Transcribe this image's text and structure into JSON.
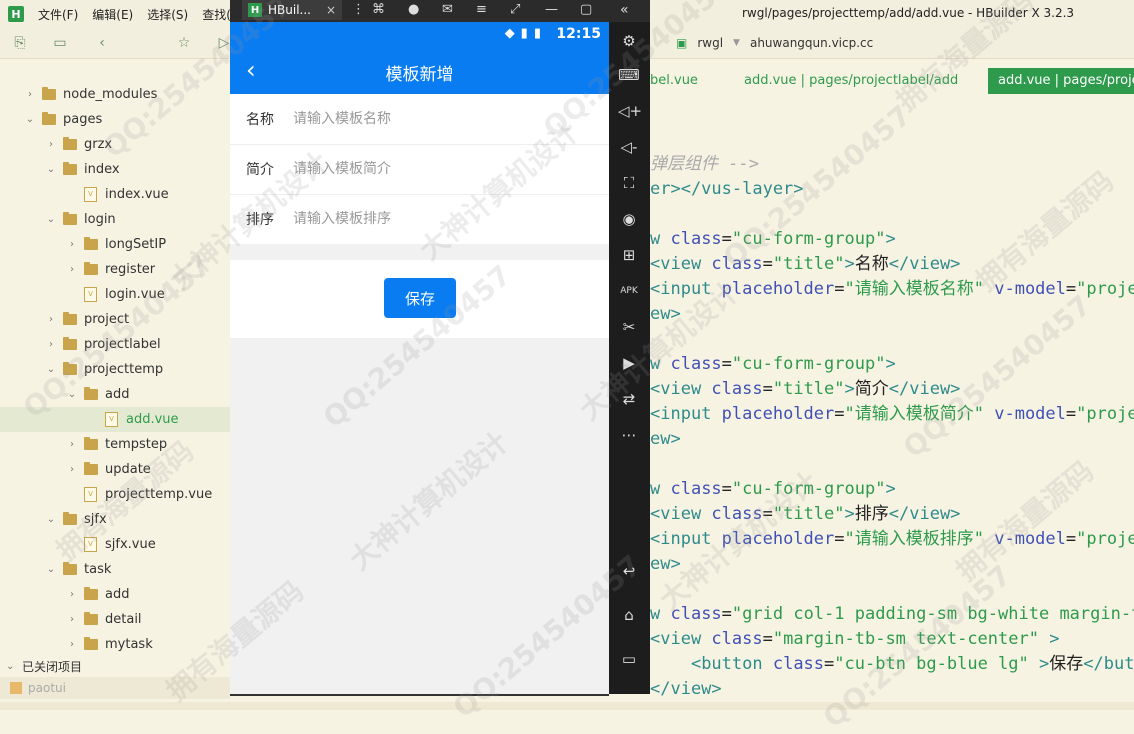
{
  "ide": {
    "window_title": "rwgl/pages/projecttemp/add/add.vue - HBuilder X 3.2.3",
    "menu": [
      "文件(F)",
      "编辑(E)",
      "选择(S)",
      "查找(I)"
    ],
    "address": {
      "project": "rwgl",
      "host": "ahuwangqun.vicp.cc"
    },
    "tabs": [
      {
        "label": "bel.vue"
      },
      {
        "label": "add.vue | pages/projectlabel/add"
      },
      {
        "label": "add.vue | pages/projec"
      }
    ],
    "tree": [
      {
        "label": "node_modules",
        "type": "folder",
        "depth": 0,
        "expanded": false
      },
      {
        "label": "pages",
        "type": "folder",
        "depth": 0,
        "expanded": true
      },
      {
        "label": "grzx",
        "type": "folder",
        "depth": 1,
        "expanded": false
      },
      {
        "label": "index",
        "type": "folder",
        "depth": 1,
        "expanded": true
      },
      {
        "label": "index.vue",
        "type": "file",
        "depth": 2
      },
      {
        "label": "login",
        "type": "folder",
        "depth": 1,
        "expanded": true
      },
      {
        "label": "longSetIP",
        "type": "folder",
        "depth": 2,
        "expanded": false
      },
      {
        "label": "register",
        "type": "folder",
        "depth": 2,
        "expanded": false
      },
      {
        "label": "login.vue",
        "type": "file",
        "depth": 2
      },
      {
        "label": "project",
        "type": "folder",
        "depth": 1,
        "expanded": false
      },
      {
        "label": "projectlabel",
        "type": "folder",
        "depth": 1,
        "expanded": false
      },
      {
        "label": "projecttemp",
        "type": "folder",
        "depth": 1,
        "expanded": true
      },
      {
        "label": "add",
        "type": "folder",
        "depth": 2,
        "expanded": true
      },
      {
        "label": "add.vue",
        "type": "file",
        "depth": 3,
        "selected": true
      },
      {
        "label": "tempstep",
        "type": "folder",
        "depth": 2,
        "expanded": false
      },
      {
        "label": "update",
        "type": "folder",
        "depth": 2,
        "expanded": false
      },
      {
        "label": "projecttemp.vue",
        "type": "file",
        "depth": 2
      },
      {
        "label": "sjfx",
        "type": "folder",
        "depth": 1,
        "expanded": true
      },
      {
        "label": "sjfx.vue",
        "type": "file",
        "depth": 2
      },
      {
        "label": "task",
        "type": "folder",
        "depth": 1,
        "expanded": true
      },
      {
        "label": "add",
        "type": "folder",
        "depth": 2,
        "expanded": false
      },
      {
        "label": "detail",
        "type": "folder",
        "depth": 2,
        "expanded": false
      },
      {
        "label": "mytask",
        "type": "folder",
        "depth": 2,
        "expanded": false
      }
    ],
    "closed_projects_label": "已关闭项目",
    "closed_project": "paotui",
    "code": [
      [
        {
          "c": "cmt",
          "t": "弹层组件 -->"
        }
      ],
      [
        {
          "c": "tag",
          "t": "er></vus-layer>"
        }
      ],
      [],
      [
        {
          "c": "tag",
          "t": "w "
        },
        {
          "c": "attr",
          "t": "class"
        },
        {
          "c": "txt",
          "t": "="
        },
        {
          "c": "str",
          "t": "\"cu-form-group\""
        },
        {
          "c": "tag",
          "t": ">"
        }
      ],
      [
        {
          "c": "tag",
          "t": "<view "
        },
        {
          "c": "attr",
          "t": "class"
        },
        {
          "c": "txt",
          "t": "="
        },
        {
          "c": "str",
          "t": "\"title\""
        },
        {
          "c": "tag",
          "t": ">"
        },
        {
          "c": "txt",
          "t": "名称"
        },
        {
          "c": "tag",
          "t": "</view>"
        }
      ],
      [
        {
          "c": "tag",
          "t": "<input "
        },
        {
          "c": "attr",
          "t": "placeholder"
        },
        {
          "c": "txt",
          "t": "="
        },
        {
          "c": "str",
          "t": "\"请输入模板名称\""
        },
        {
          "c": "txt",
          "t": " "
        },
        {
          "c": "attr",
          "t": "v-model"
        },
        {
          "c": "txt",
          "t": "="
        },
        {
          "c": "str",
          "t": "\"proje"
        }
      ],
      [
        {
          "c": "tag",
          "t": "ew>"
        }
      ],
      [],
      [
        {
          "c": "tag",
          "t": "w "
        },
        {
          "c": "attr",
          "t": "class"
        },
        {
          "c": "txt",
          "t": "="
        },
        {
          "c": "str",
          "t": "\"cu-form-group\""
        },
        {
          "c": "tag",
          "t": ">"
        }
      ],
      [
        {
          "c": "tag",
          "t": "<view "
        },
        {
          "c": "attr",
          "t": "class"
        },
        {
          "c": "txt",
          "t": "="
        },
        {
          "c": "str",
          "t": "\"title\""
        },
        {
          "c": "tag",
          "t": ">"
        },
        {
          "c": "txt",
          "t": "简介"
        },
        {
          "c": "tag",
          "t": "</view>"
        }
      ],
      [
        {
          "c": "tag",
          "t": "<input "
        },
        {
          "c": "attr",
          "t": "placeholder"
        },
        {
          "c": "txt",
          "t": "="
        },
        {
          "c": "str",
          "t": "\"请输入模板简介\""
        },
        {
          "c": "txt",
          "t": " "
        },
        {
          "c": "attr",
          "t": "v-model"
        },
        {
          "c": "txt",
          "t": "="
        },
        {
          "c": "str",
          "t": "\"proje"
        }
      ],
      [
        {
          "c": "tag",
          "t": "ew>"
        }
      ],
      [],
      [
        {
          "c": "tag",
          "t": "w "
        },
        {
          "c": "attr",
          "t": "class"
        },
        {
          "c": "txt",
          "t": "="
        },
        {
          "c": "str",
          "t": "\"cu-form-group\""
        },
        {
          "c": "tag",
          "t": ">"
        }
      ],
      [
        {
          "c": "tag",
          "t": "<view "
        },
        {
          "c": "attr",
          "t": "class"
        },
        {
          "c": "txt",
          "t": "="
        },
        {
          "c": "str",
          "t": "\"title\""
        },
        {
          "c": "tag",
          "t": ">"
        },
        {
          "c": "txt",
          "t": "排序"
        },
        {
          "c": "tag",
          "t": "</view>"
        }
      ],
      [
        {
          "c": "tag",
          "t": "<input "
        },
        {
          "c": "attr",
          "t": "placeholder"
        },
        {
          "c": "txt",
          "t": "="
        },
        {
          "c": "str",
          "t": "\"请输入模板排序\""
        },
        {
          "c": "txt",
          "t": " "
        },
        {
          "c": "attr",
          "t": "v-model"
        },
        {
          "c": "txt",
          "t": "="
        },
        {
          "c": "str",
          "t": "\"proje"
        }
      ],
      [
        {
          "c": "tag",
          "t": "ew>"
        }
      ],
      [],
      [
        {
          "c": "tag",
          "t": "w "
        },
        {
          "c": "attr",
          "t": "class"
        },
        {
          "c": "txt",
          "t": "="
        },
        {
          "c": "str",
          "t": "\"grid col-1 padding-sm bg-white margin-to"
        }
      ],
      [
        {
          "c": "tag",
          "t": "<view "
        },
        {
          "c": "attr",
          "t": "class"
        },
        {
          "c": "txt",
          "t": "="
        },
        {
          "c": "str",
          "t": "\"margin-tb-sm text-center\""
        },
        {
          "c": "txt",
          "t": " "
        },
        {
          "c": "tag",
          "t": ">"
        }
      ],
      [
        {
          "c": "txt",
          "t": "    "
        },
        {
          "c": "tag",
          "t": "<button "
        },
        {
          "c": "attr",
          "t": "class"
        },
        {
          "c": "txt",
          "t": "="
        },
        {
          "c": "str",
          "t": "\"cu-btn bg-blue lg\""
        },
        {
          "c": "txt",
          "t": " "
        },
        {
          "c": "tag",
          "t": ">"
        },
        {
          "c": "txt",
          "t": "保存"
        },
        {
          "c": "tag",
          "t": "</butt"
        }
      ],
      [
        {
          "c": "tag",
          "t": "</view>"
        }
      ]
    ]
  },
  "emulator": {
    "tab_label": "HBuil...",
    "clock": "12:15",
    "nav_title": "模板新增",
    "form": [
      {
        "label": "名称",
        "placeholder": "请输入模板名称"
      },
      {
        "label": "简介",
        "placeholder": "请输入模板简介"
      },
      {
        "label": "排序",
        "placeholder": "请输入模板排序"
      }
    ],
    "save_label": "保存"
  },
  "watermarks": [
    "QQ:254540457",
    "大神计算机设计",
    "拥有海量源码"
  ],
  "colors": {
    "primary": "#0a7cf2",
    "ide_green": "#2e9b4c",
    "ide_bg": "#f7f3e3"
  }
}
